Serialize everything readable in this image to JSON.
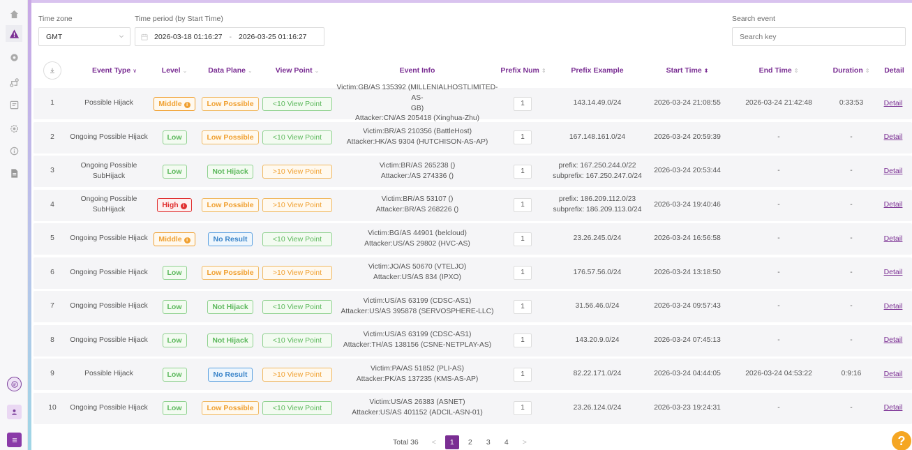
{
  "filters": {
    "timezone_label": "Time zone",
    "timezone_value": "GMT",
    "period_label": "Time period (by Start Time)",
    "period_start": "2026-03-18 01:16:27",
    "period_sep": "-",
    "period_end": "2026-03-25 01:16:27",
    "search_label": "Search event",
    "search_placeholder": "Search key"
  },
  "table": {
    "columns": {
      "event_type": "Event Type",
      "level": "Level",
      "data_plane": "Data Plane",
      "view_point": "View Point",
      "event_info": "Event Info",
      "prefix_num": "Prefix Num",
      "prefix_example": "Prefix Example",
      "start_time": "Start Time",
      "end_time": "End Time",
      "duration": "Duration",
      "detail": "Detail"
    },
    "rows": [
      {
        "index": "1",
        "event_type": "Possible Hijack",
        "level": "Middle",
        "level_class": "lv-middle",
        "level_icon": true,
        "data_plane": "Low Possible",
        "dp_class": "dp-low",
        "view_point": "<10 View Point",
        "vp_class": "vp-lt",
        "info1": "Victim:GB/AS 135392 (MILLENIALHOSTLIMITED-AS-",
        "info2": "GB)",
        "info3": "Attacker:CN/AS 205418 (Xinghua-Zhu)",
        "prefix_num": "1",
        "prefix1": "143.14.49.0/24",
        "prefix2": "",
        "start": "2026-03-24 21:08:55",
        "end": "2026-03-24 21:42:48",
        "duration": "0:33:53",
        "detail": "Detail"
      },
      {
        "index": "2",
        "event_type": "Ongoing Possible Hijack",
        "level": "Low",
        "level_class": "lv-low",
        "level_icon": false,
        "data_plane": "Low Possible",
        "dp_class": "dp-low",
        "view_point": "<10 View Point",
        "vp_class": "vp-lt",
        "info1": "Victim:BR/AS 210356 (BattleHost)",
        "info2": "Attacker:HK/AS 9304 (HUTCHISON-AS-AP)",
        "info3": "",
        "prefix_num": "1",
        "prefix1": "167.148.161.0/24",
        "prefix2": "",
        "start": "2026-03-24 20:59:39",
        "end": "-",
        "duration": "-",
        "detail": "Detail"
      },
      {
        "index": "3",
        "event_type": "Ongoing Possible SubHijack",
        "level": "Low",
        "level_class": "lv-low",
        "level_icon": false,
        "data_plane": "Not Hijack",
        "dp_class": "dp-not",
        "view_point": ">10 View Point",
        "vp_class": "vp-gt",
        "info1": "Victim:BR/AS 265238 ()",
        "info2": "Attacker:/AS 274336 ()",
        "info3": "",
        "prefix_num": "1",
        "prefix1": "prefix: 167.250.244.0/22",
        "prefix2": "subprefix: 167.250.247.0/24",
        "start": "2026-03-24 20:53:44",
        "end": "-",
        "duration": "-",
        "detail": "Detail"
      },
      {
        "index": "4",
        "event_type": "Ongoing Possible SubHijack",
        "level": "High",
        "level_class": "lv-high",
        "level_icon": true,
        "data_plane": "Low Possible",
        "dp_class": "dp-low",
        "view_point": ">10 View Point",
        "vp_class": "vp-gt",
        "info1": "Victim:BR/AS 53107 ()",
        "info2": "Attacker:BR/AS 268226 ()",
        "info3": "",
        "prefix_num": "1",
        "prefix1": "prefix: 186.209.112.0/23",
        "prefix2": "subprefix: 186.209.113.0/24",
        "start": "2026-03-24 19:40:46",
        "end": "-",
        "duration": "-",
        "detail": "Detail"
      },
      {
        "index": "5",
        "event_type": "Ongoing Possible Hijack",
        "level": "Middle",
        "level_class": "lv-middle",
        "level_icon": true,
        "data_plane": "No Result",
        "dp_class": "dp-none",
        "view_point": "<10 View Point",
        "vp_class": "vp-lt",
        "info1": "Victim:BG/AS 44901 (belcloud)",
        "info2": "Attacker:US/AS 29802 (HVC-AS)",
        "info3": "",
        "prefix_num": "1",
        "prefix1": "23.26.245.0/24",
        "prefix2": "",
        "start": "2026-03-24 16:56:58",
        "end": "-",
        "duration": "-",
        "detail": "Detail"
      },
      {
        "index": "6",
        "event_type": "Ongoing Possible Hijack",
        "level": "Low",
        "level_class": "lv-low",
        "level_icon": false,
        "data_plane": "Low Possible",
        "dp_class": "dp-low",
        "view_point": ">10 View Point",
        "vp_class": "vp-gt",
        "info1": "Victim:JO/AS 50670 (VTELJO)",
        "info2": "Attacker:US/AS 834 (IPXO)",
        "info3": "",
        "prefix_num": "1",
        "prefix1": "176.57.56.0/24",
        "prefix2": "",
        "start": "2026-03-24 13:18:50",
        "end": "-",
        "duration": "-",
        "detail": "Detail"
      },
      {
        "index": "7",
        "event_type": "Ongoing Possible Hijack",
        "level": "Low",
        "level_class": "lv-low",
        "level_icon": false,
        "data_plane": "Not Hijack",
        "dp_class": "dp-not",
        "view_point": "<10 View Point",
        "vp_class": "vp-lt",
        "info1": "Victim:US/AS 63199 (CDSC-AS1)",
        "info2": "Attacker:US/AS 395878 (SERVOSPHERE-LLC)",
        "info3": "",
        "prefix_num": "1",
        "prefix1": "31.56.46.0/24",
        "prefix2": "",
        "start": "2026-03-24 09:57:43",
        "end": "-",
        "duration": "-",
        "detail": "Detail"
      },
      {
        "index": "8",
        "event_type": "Ongoing Possible Hijack",
        "level": "Low",
        "level_class": "lv-low",
        "level_icon": false,
        "data_plane": "Not Hijack",
        "dp_class": "dp-not",
        "view_point": "<10 View Point",
        "vp_class": "vp-lt",
        "info1": "Victim:US/AS 63199 (CDSC-AS1)",
        "info2": "Attacker:TH/AS 138156 (CSNE-NETPLAY-AS)",
        "info3": "",
        "prefix_num": "1",
        "prefix1": "143.20.9.0/24",
        "prefix2": "",
        "start": "2026-03-24 07:45:13",
        "end": "-",
        "duration": "-",
        "detail": "Detail"
      },
      {
        "index": "9",
        "event_type": "Possible Hijack",
        "level": "Low",
        "level_class": "lv-low",
        "level_icon": false,
        "data_plane": "No Result",
        "dp_class": "dp-none",
        "view_point": ">10 View Point",
        "vp_class": "vp-gt",
        "info1": "Victim:PA/AS 51852 (PLI-AS)",
        "info2": "Attacker:PK/AS 137235 (KMS-AS-AP)",
        "info3": "",
        "prefix_num": "1",
        "prefix1": "82.22.171.0/24",
        "prefix2": "",
        "start": "2026-03-24 04:44:05",
        "end": "2026-03-24 04:53:22",
        "duration": "0:9:16",
        "detail": "Detail"
      },
      {
        "index": "10",
        "event_type": "Ongoing Possible Hijack",
        "level": "Low",
        "level_class": "lv-low",
        "level_icon": false,
        "data_plane": "Low Possible",
        "dp_class": "dp-low",
        "view_point": "<10 View Point",
        "vp_class": "vp-lt",
        "info1": "Victim:US/AS 26383 (ASNET)",
        "info2": "Attacker:US/AS 401152 (ADCIL-ASN-01)",
        "info3": "",
        "prefix_num": "1",
        "prefix1": "23.26.124.0/24",
        "prefix2": "",
        "start": "2026-03-23 19:24:31",
        "end": "-",
        "duration": "-",
        "detail": "Detail"
      }
    ]
  },
  "pagination": {
    "total": "Total 36",
    "pages": [
      "1",
      "2",
      "3",
      "4"
    ],
    "prev": "<",
    "next": ">"
  },
  "help_label": "?",
  "colors": {
    "accent": "#7a2e93",
    "low": "#5cb85c",
    "middle": "#f0a030",
    "high": "#e03030",
    "no_result": "#3a84c9"
  }
}
